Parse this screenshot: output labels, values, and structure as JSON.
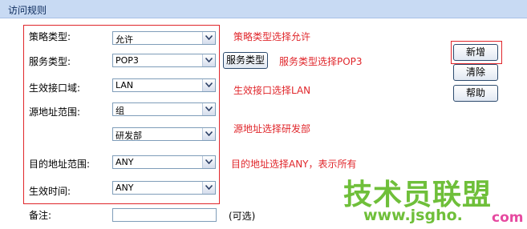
{
  "header": {
    "title": "访问规则"
  },
  "form": {
    "policy_type": {
      "label": "策略类型:",
      "value": "允许"
    },
    "service_type": {
      "label": "服务类型:",
      "value": "POP3",
      "button": "服务类型"
    },
    "interface": {
      "label": "生效接口域:",
      "value": "LAN"
    },
    "src_range": {
      "label": "源地址范围:",
      "value": "组",
      "group_value": "研发部"
    },
    "dst_range": {
      "label": "目的地址范围:",
      "value": "ANY"
    },
    "time": {
      "label": "生效时间:",
      "value": "ANY"
    },
    "remark": {
      "label": "备注:",
      "value": "",
      "hint": "(可选)"
    }
  },
  "annotations": {
    "policy": "策略类型选择允许",
    "service": "服务类型选择POP3",
    "interface": "生效接口选择LAN",
    "src": "源地址选择研发部",
    "dst": "目的地址选择ANY，表示所有"
  },
  "actions": {
    "add": "新增",
    "clear": "清除",
    "help": "帮助"
  },
  "watermark": {
    "brand": "技术员联盟",
    "url": "www.jsgho.",
    "tld": "com"
  },
  "colors": {
    "highlight": "#e0262b",
    "header_bg": "#c8daf3",
    "watermark_green": "#6fbf3a",
    "watermark_pink": "#e64aa0"
  }
}
